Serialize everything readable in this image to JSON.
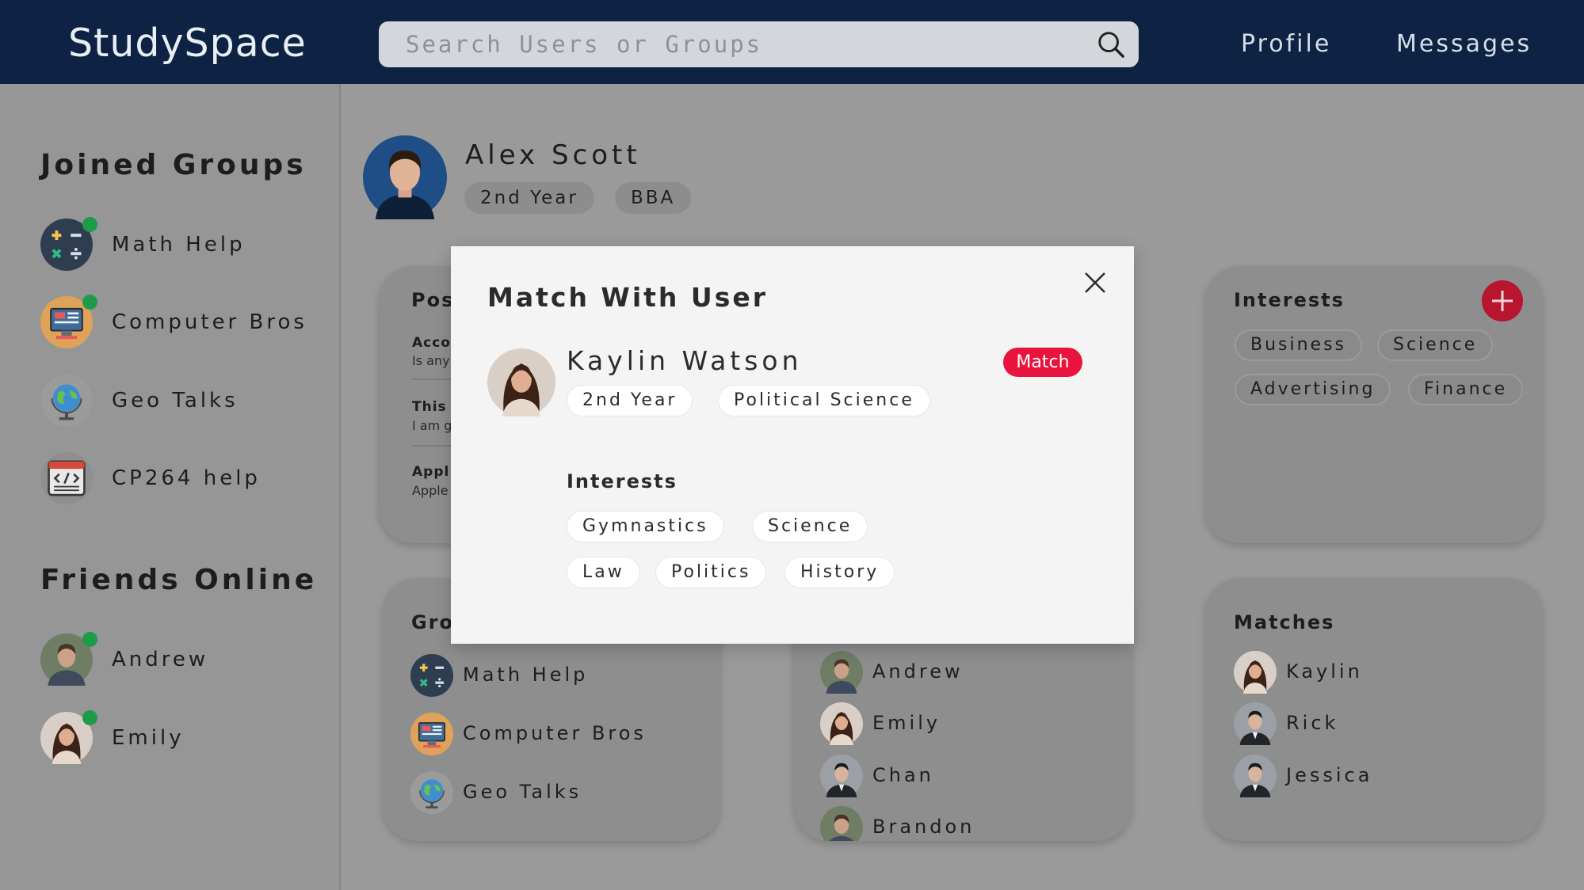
{
  "header": {
    "brand": "StudySpace",
    "search_placeholder": "Search Users or Groups",
    "nav": {
      "profile": "Profile",
      "messages": "Messages"
    }
  },
  "sidebar": {
    "joined_title": "Joined Groups",
    "joined_groups": [
      {
        "label": "Math Help",
        "icon": "math-icon",
        "online": true
      },
      {
        "label": "Computer Bros",
        "icon": "computer-icon",
        "online": true
      },
      {
        "label": "Geo Talks",
        "icon": "globe-icon",
        "online": false
      },
      {
        "label": "CP264 help",
        "icon": "code-icon",
        "online": false
      }
    ],
    "friends_title": "Friends Online",
    "friends": [
      {
        "label": "Andrew",
        "online": true
      },
      {
        "label": "Emily",
        "online": true
      }
    ]
  },
  "profile": {
    "name": "Alex Scott",
    "year": "2nd Year",
    "program": "BBA"
  },
  "posts_card": {
    "title": "Pos",
    "posts": [
      {
        "heading": "Acco",
        "body": "Is any"
      },
      {
        "heading": "This",
        "body": "I am g"
      },
      {
        "heading": "Appl",
        "body": "Apple"
      }
    ]
  },
  "interests_card": {
    "title": "Interests",
    "tags": [
      "Business",
      "Science",
      "Advertising",
      "Finance"
    ]
  },
  "groups_card": {
    "title": "Gro",
    "items": [
      "Math Help",
      "Computer Bros",
      "Geo Talks"
    ]
  },
  "friends_card": {
    "items": [
      "Andrew",
      "Emily",
      "Chan",
      "Brandon"
    ]
  },
  "matches_card": {
    "title": "Matches",
    "items": [
      "Kaylin",
      "Rick",
      "Jessica"
    ]
  },
  "modal": {
    "title": "Match With User",
    "user_name": "Kaylin Watson",
    "year": "2nd Year",
    "program": "Political Science",
    "match_label": "Match",
    "interests_title": "Interests",
    "interests": [
      "Gymnastics",
      "Science",
      "Law",
      "Politics",
      "History"
    ]
  },
  "colors": {
    "topbar": "#0e2343",
    "overlay_gray": "#9a9a9a",
    "online_dot": "#1d9b48",
    "match_red": "#e8143d",
    "add_red": "#b8152f"
  }
}
